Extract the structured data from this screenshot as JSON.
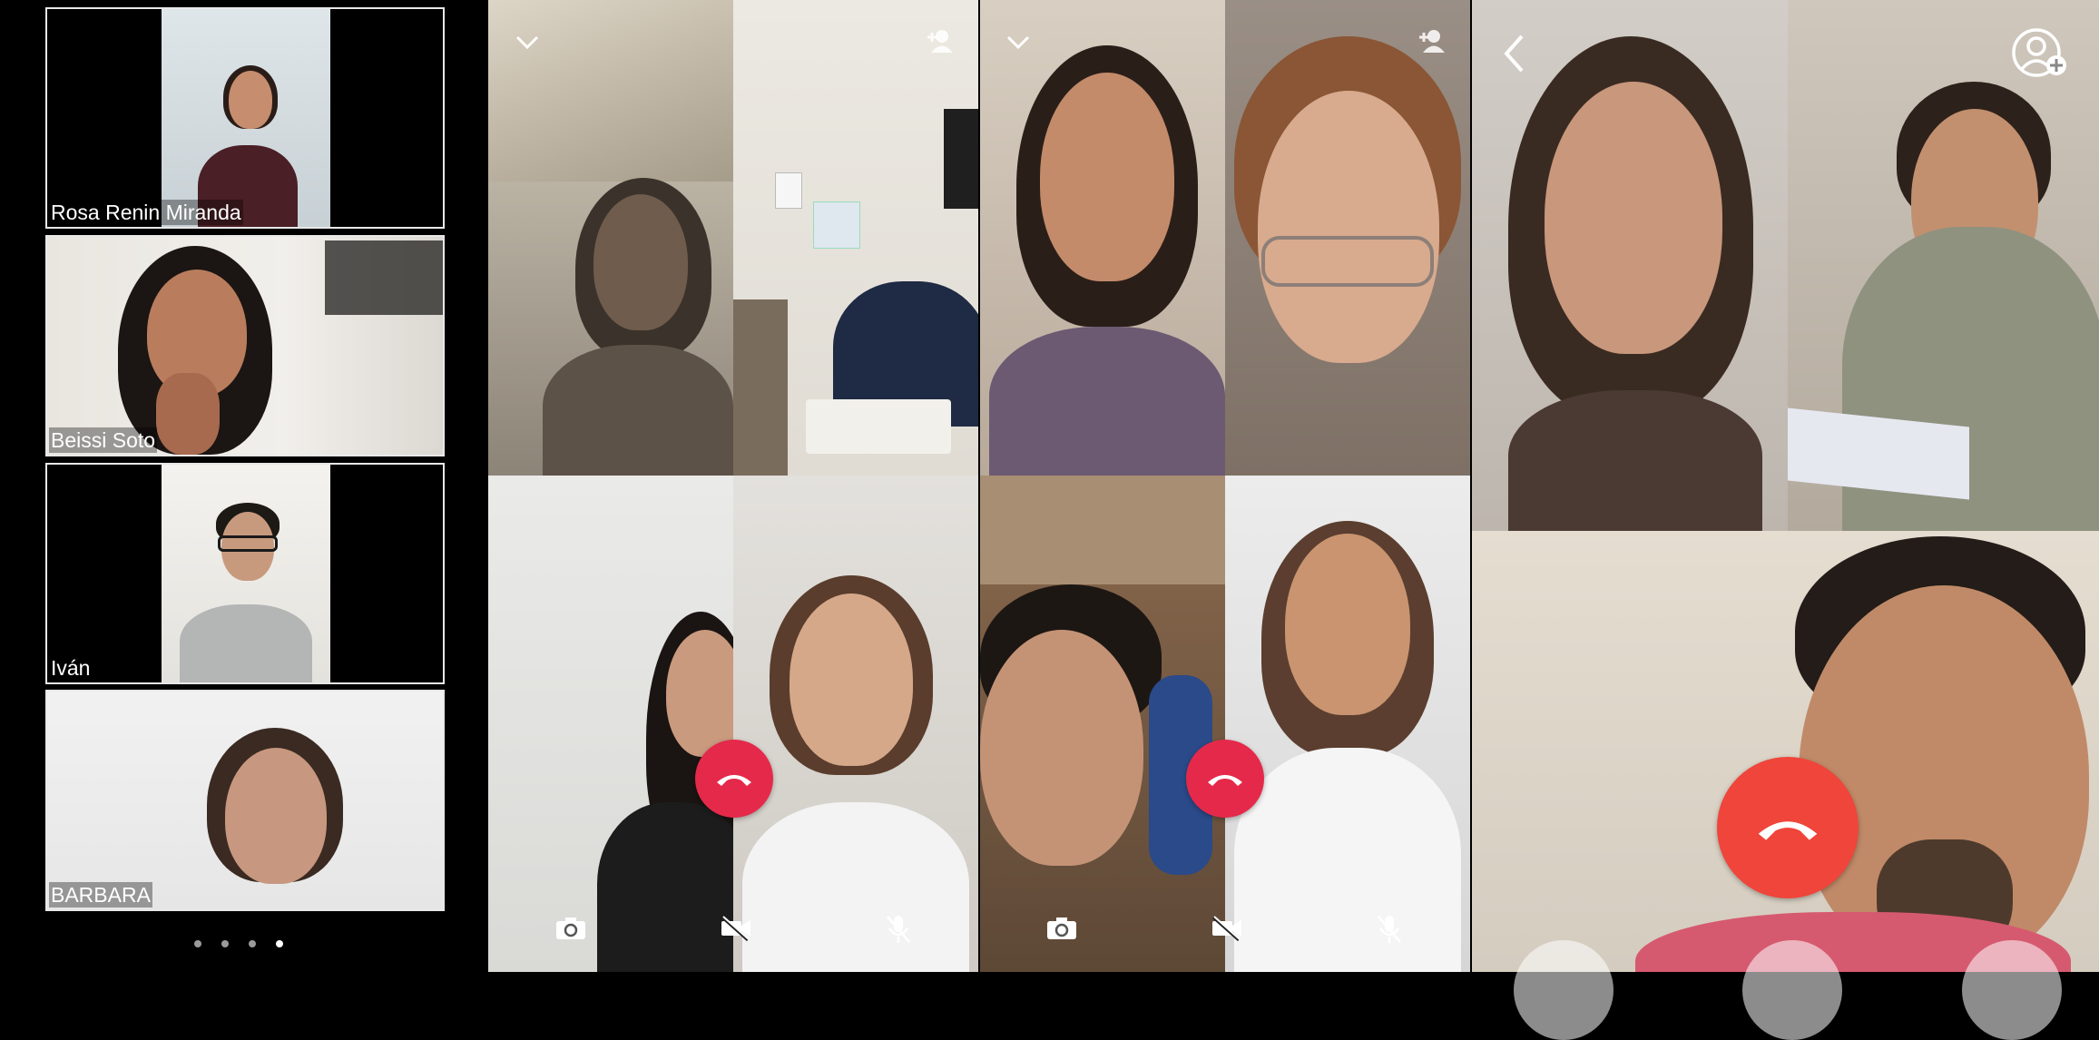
{
  "participants_sidebar": [
    {
      "name": "Rosa Renin Miranda"
    },
    {
      "name": "Beissi Soto"
    },
    {
      "name": "Iván"
    },
    {
      "name": "BARBARA"
    }
  ],
  "pagination": {
    "pages": 4,
    "active_page": 4
  },
  "icons": {
    "collapse": "chevron-down-icon",
    "add_person": "add-person-icon",
    "back": "chevron-left-icon",
    "add_user_circle": "add-user-circle-icon",
    "hangup": "phone-hangup-icon",
    "switch_camera": "switch-camera-icon",
    "video_off": "video-off-icon",
    "mic_off": "mic-off-icon"
  },
  "colors": {
    "hangup_red": "#e5294a",
    "hangup_large": "#f0453a",
    "border": "#e8e8e8"
  }
}
